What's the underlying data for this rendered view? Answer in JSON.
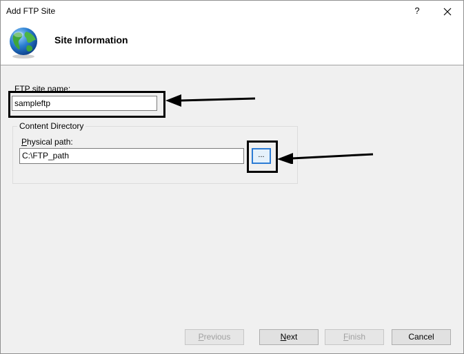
{
  "window": {
    "title": "Add FTP Site",
    "help_label": "?",
    "close_label": "✕"
  },
  "header": {
    "heading": "Site Information",
    "icon": "globe-icon"
  },
  "form": {
    "site_name_label_prefix": "F",
    "site_name_label_rest": "TP site name:",
    "site_name_value": "sampleftp",
    "content_directory_legend": "Content Directory",
    "physical_path_label_prefix": "P",
    "physical_path_label_rest": "hysical path:",
    "physical_path_value": "C:\\FTP_path",
    "browse_label": "..."
  },
  "footer": {
    "previous": {
      "prefix": "P",
      "rest": "revious",
      "enabled": false
    },
    "next": {
      "prefix": "N",
      "rest": "ext",
      "enabled": true
    },
    "finish": {
      "prefix": "F",
      "rest": "inish",
      "enabled": false
    },
    "cancel": {
      "label": "Cancel",
      "enabled": true
    }
  }
}
